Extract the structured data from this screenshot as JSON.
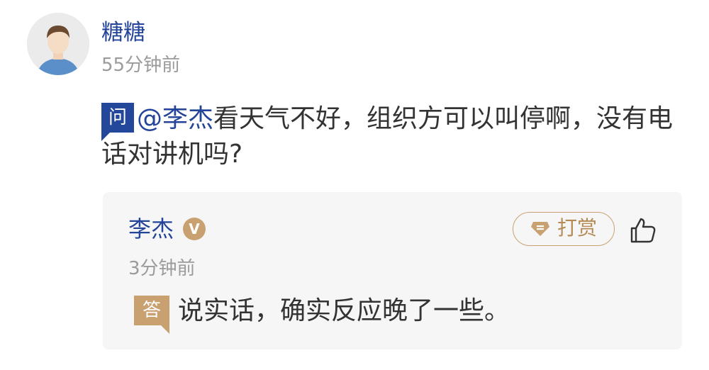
{
  "question_author": {
    "name": "糖糖",
    "time": "55分钟前",
    "avatar_icon": "default-user-avatar"
  },
  "question": {
    "badge": "问",
    "mention": "@李杰",
    "text": "看天气不好，组织方可以叫停啊，没有电话对讲机吗?"
  },
  "answer": {
    "author": "李杰",
    "verified_badge": "V",
    "tip_label": "打赏",
    "tip_icon": "gem-icon",
    "like_icon": "thumbs-up-icon",
    "time": "3分钟前",
    "badge": "答",
    "text": "说实话，确实反应晚了一些。"
  },
  "colors": {
    "link_blue": "#24449a",
    "question_badge": "#22479b",
    "gold": "#c9a171",
    "card_background": "#f6f6f6"
  }
}
